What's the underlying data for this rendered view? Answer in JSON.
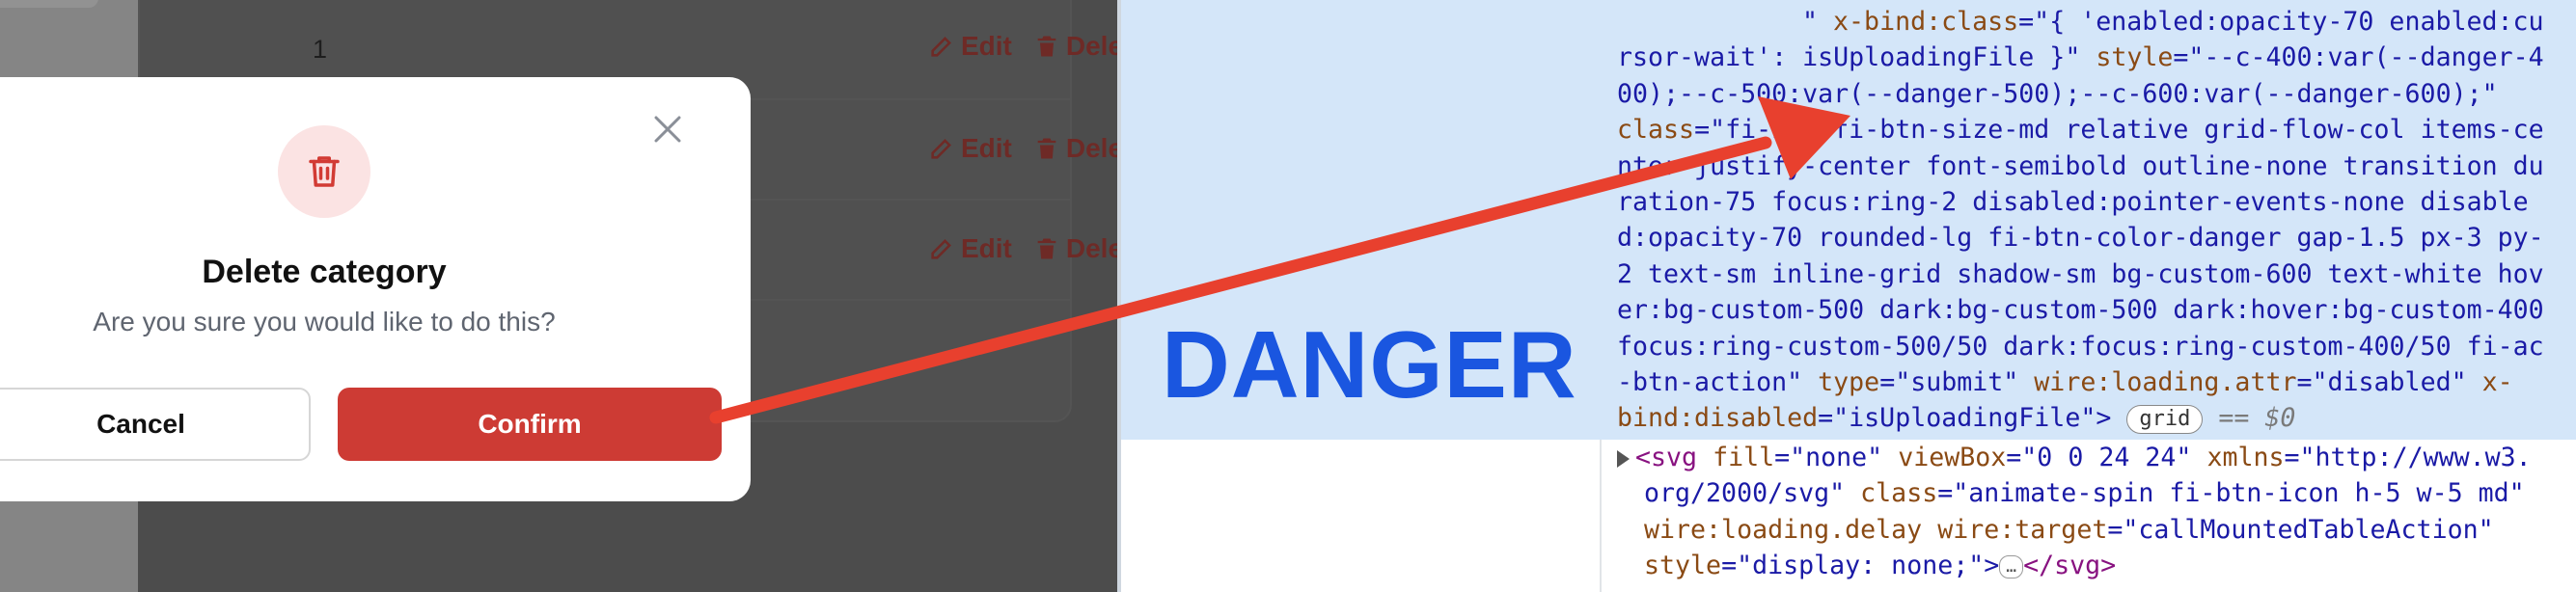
{
  "table": {
    "rows": [
      {
        "number": "1",
        "edit_label": "Edit",
        "delete_label": "Delete"
      },
      {
        "number": "",
        "edit_label": "Edit",
        "delete_label": "Delete"
      },
      {
        "number": "",
        "edit_label": "Edit",
        "delete_label": "Delete"
      }
    ]
  },
  "modal": {
    "title": "Delete category",
    "description": "Are you sure you would like to do this?",
    "cancel_label": "Cancel",
    "confirm_label": "Confirm",
    "icon": "trash-icon",
    "close_icon": "close-icon"
  },
  "annotation": {
    "label": "DANGER",
    "arrow_color": "#e8402e"
  },
  "devtools": {
    "line1_a": "\" ",
    "line1_attr": "x-bind:class",
    "line1_b": "=\"{ 'enabled:opacity-70 enabled:cu",
    "line2": "rsor-wait': isUploadingFile }\" ",
    "line2_attr": "style",
    "line2_b": "=\"--c-400:var(--danger-4",
    "line3": "00);--c-500:var(--danger-500);--c-600:var(--danger-600);\"",
    "line4_attr": "class",
    "line4_b": "=\"fi-btn fi-btn-size-md relative grid-flow-col items-ce",
    "line5": "nter justify-center font-semibold outline-none transition du",
    "line6": "ration-75 focus:ring-2 disabled:pointer-events-none disable",
    "line7": "d:opacity-70 rounded-lg fi-btn-color-danger gap-1.5 px-3 py-",
    "line8": "2 text-sm inline-grid shadow-sm bg-custom-600 text-white hov",
    "line9": "er:bg-custom-500 dark:bg-custom-500 dark:hover:bg-custom-400",
    "line10": "focus:ring-custom-500/50 dark:focus:ring-custom-400/50 fi-ac",
    "line11_a": "-btn-action\" ",
    "line11_attr1": "type",
    "line11_b": "=\"submit\" ",
    "line11_attr2": "wire:loading.attr",
    "line11_c": "=\"disabled\" ",
    "line11_attr3": "x-",
    "line12_attr": "bind:disabled",
    "line12_b": "=\"isUploadingFile\">",
    "grid_badge": "grid",
    "eq_text": "== $0",
    "svg_line1_tag": "<svg",
    "svg_line1_attr1": "fill",
    "svg_line1_v1": "=\"none\"",
    "svg_line1_attr2": "viewBox",
    "svg_line1_v2": "=\"0 0 24 24\"",
    "svg_line1_attr3": "xmlns",
    "svg_line1_v3": "=\"http://www.w3.",
    "svg_line2_v": "org/2000/svg\"",
    "svg_line2_attr": "class",
    "svg_line2_v2": "=\"animate-spin fi-btn-icon h-5 w-5  md\"",
    "svg_line3_attr1": "wire:loading.delay",
    "svg_line3_attr2": "wire:target",
    "svg_line3_v": "=\"callMountedTableAction\"",
    "svg_line4_attr": "style",
    "svg_line4_v": "=\"display: none;\">",
    "svg_ellipsis": "…",
    "svg_close": "</svg>"
  }
}
